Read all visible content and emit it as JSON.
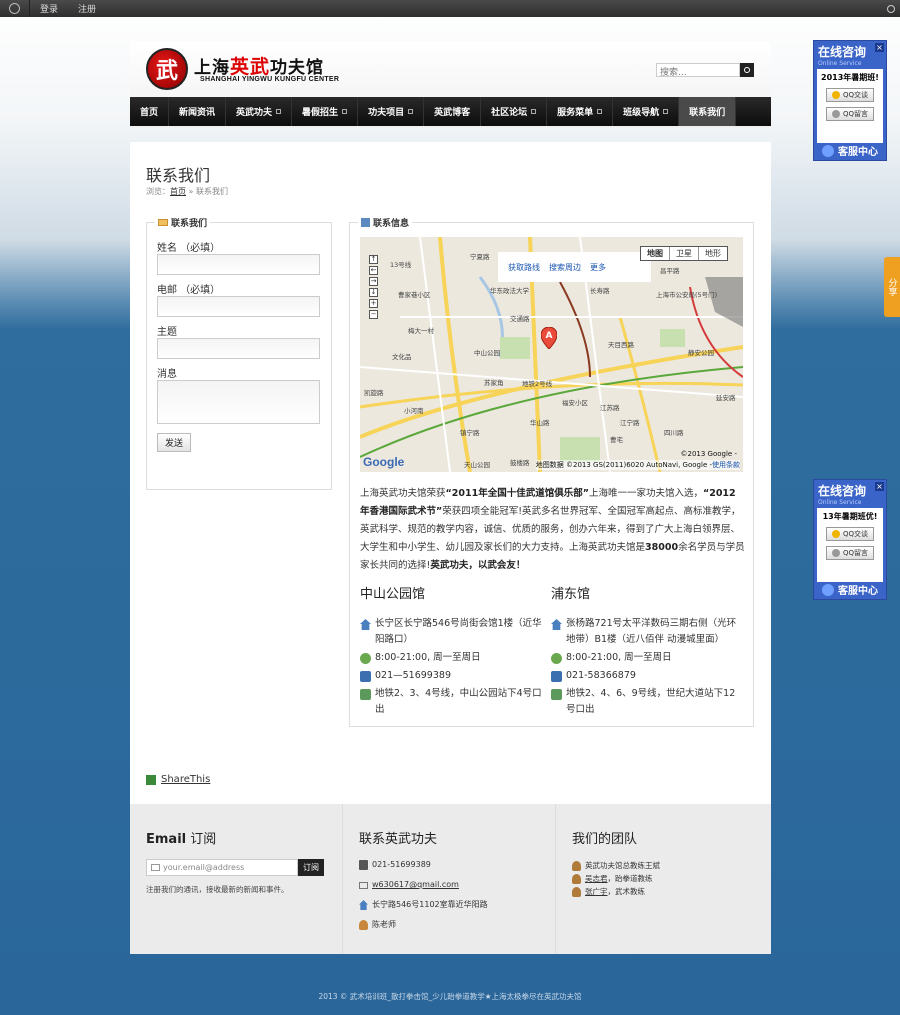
{
  "adminbar": {
    "login": "登录",
    "register": "注册"
  },
  "header": {
    "logo_badge": "武",
    "logo_cn_1": "上海",
    "logo_cn_2": "英武",
    "logo_cn_3": "功夫馆",
    "logo_en": "SHANGHAI YINGWU KUNGFU CENTER",
    "search_placeholder": "搜索..."
  },
  "nav": [
    {
      "label": "首页",
      "dropdown": false
    },
    {
      "label": "新闻资讯",
      "dropdown": false
    },
    {
      "label": "英武功夫",
      "dropdown": true
    },
    {
      "label": "暑假招生",
      "dropdown": true
    },
    {
      "label": "功夫项目",
      "dropdown": true
    },
    {
      "label": "英武博客",
      "dropdown": false
    },
    {
      "label": "社区论坛",
      "dropdown": true
    },
    {
      "label": "服务菜单",
      "dropdown": true
    },
    {
      "label": "班级导航",
      "dropdown": true
    },
    {
      "label": "联系我们",
      "dropdown": false,
      "active": true
    }
  ],
  "page": {
    "title": "联系我们",
    "breadcrumb_prefix": "浏览：",
    "breadcrumb_home": "首页",
    "breadcrumb_sep": "»",
    "breadcrumb_current": "联系我们"
  },
  "form": {
    "title": "联系我们",
    "name_label": "姓名 （必填）",
    "email_label": "电邮 （必填）",
    "subject_label": "主题",
    "message_label": "消息",
    "submit": "发送"
  },
  "info": {
    "title": "联系信息",
    "map": {
      "links": [
        "获取路线",
        "搜索周边",
        "更多"
      ],
      "types": [
        "地图",
        "卫星",
        "地形"
      ],
      "copyright1": "©2013 Google -",
      "copyright2": "地图数据 ©2013 GS(2011)6020 AutoNavi, Google -",
      "terms": "使用条款",
      "google": "Google",
      "marker": "A",
      "labels": [
        "13号线",
        "宁夏路",
        "曹家巷小区",
        "华东政法大学",
        "长寿路",
        "昌平路",
        "上海市公安局(5号门)",
        "梅大一村",
        "交通路",
        "文化品",
        "中山公园",
        "天目西路",
        "苏家角",
        "地铁2号线",
        "静安公园",
        "延安路",
        "福安小区",
        "小河南",
        "凯旋路",
        "镇宁路",
        "华山路",
        "江苏路",
        "天山公园",
        "鼓楼路",
        "曹宅",
        "江宁路",
        "四川路"
      ]
    },
    "intro_1": "上海英武功夫馆荣获",
    "intro_b1": "“2011年全国十佳武道馆俱乐部”",
    "intro_2": "上海唯一一家功夫馆入选，",
    "intro_b2": "“2012年香港国际武术节”",
    "intro_3": "荣获四项全能冠军!英武多名世界冠军、全国冠军高起点、高标准教学，英武科学、规范的教学内容，诚信、优质的服务，创办六年来，得到了广大上海白领界层、大学生和中小学生、幼儿园及家长们的大力支持。上海英武功夫馆是",
    "intro_b3": "38000",
    "intro_4": "余名学员与学员家长共同的选择!",
    "intro_b4": "英武功夫，以武会友！",
    "branches": [
      {
        "name": "中山公园馆",
        "address": "长宁区长宁路546号尚街会馆1楼（近华阳路口）",
        "hours": "8:00-21:00, 周一至周日",
        "phone": "021—51699389",
        "transit": "地铁2、3、4号线，中山公园站下4号口出"
      },
      {
        "name": "浦东馆",
        "address": "张杨路721号太平洋数码三期右侧（光环地带）B1楼（近八佰伴 动漫城里面）",
        "hours": "8:00-21:00, 周一至周日",
        "phone": "021-58366879",
        "transit": "地铁2、4、6、9号线，世纪大道站下12号口出"
      }
    ]
  },
  "share_label": "ShareThis",
  "footer": {
    "subscribe_title_1": "Email",
    "subscribe_title_2": " 订阅",
    "email_placeholder": "your.email@address",
    "subscribe_btn": "订阅",
    "subscribe_note": "注册我们的通讯，接收最新的新闻和事件。",
    "contact_title": "联系英武功夫",
    "contact_phone": "021-51699389",
    "contact_email": "w630617@qmail.com",
    "contact_address": "长宁路546号1102室靠近华阳路",
    "contact_person": "陈老师",
    "team_title": "我们的团队",
    "team": [
      {
        "name": "英武功夫馆总教练王斌",
        "linked": false
      },
      {
        "name": "吴志君",
        "suffix": "，跆拳道教练",
        "linked": true
      },
      {
        "name": "张广宇",
        "suffix": "，武术教练",
        "linked": true
      }
    ]
  },
  "copyright": "2013 © 武术培训班_散打拳击馆_少儿跆拳道教学★上海太极拳尽在英武功夫馆",
  "qq_widget": {
    "title": "在线咨询",
    "subtitle": "Online Service",
    "close": "×",
    "announce_1": "2013年暑期班!",
    "announce_2": "13年暑期班优!",
    "chat": "QQ交谈",
    "message": "QQ留言",
    "service": "客服中心"
  },
  "share_tab": "分享"
}
